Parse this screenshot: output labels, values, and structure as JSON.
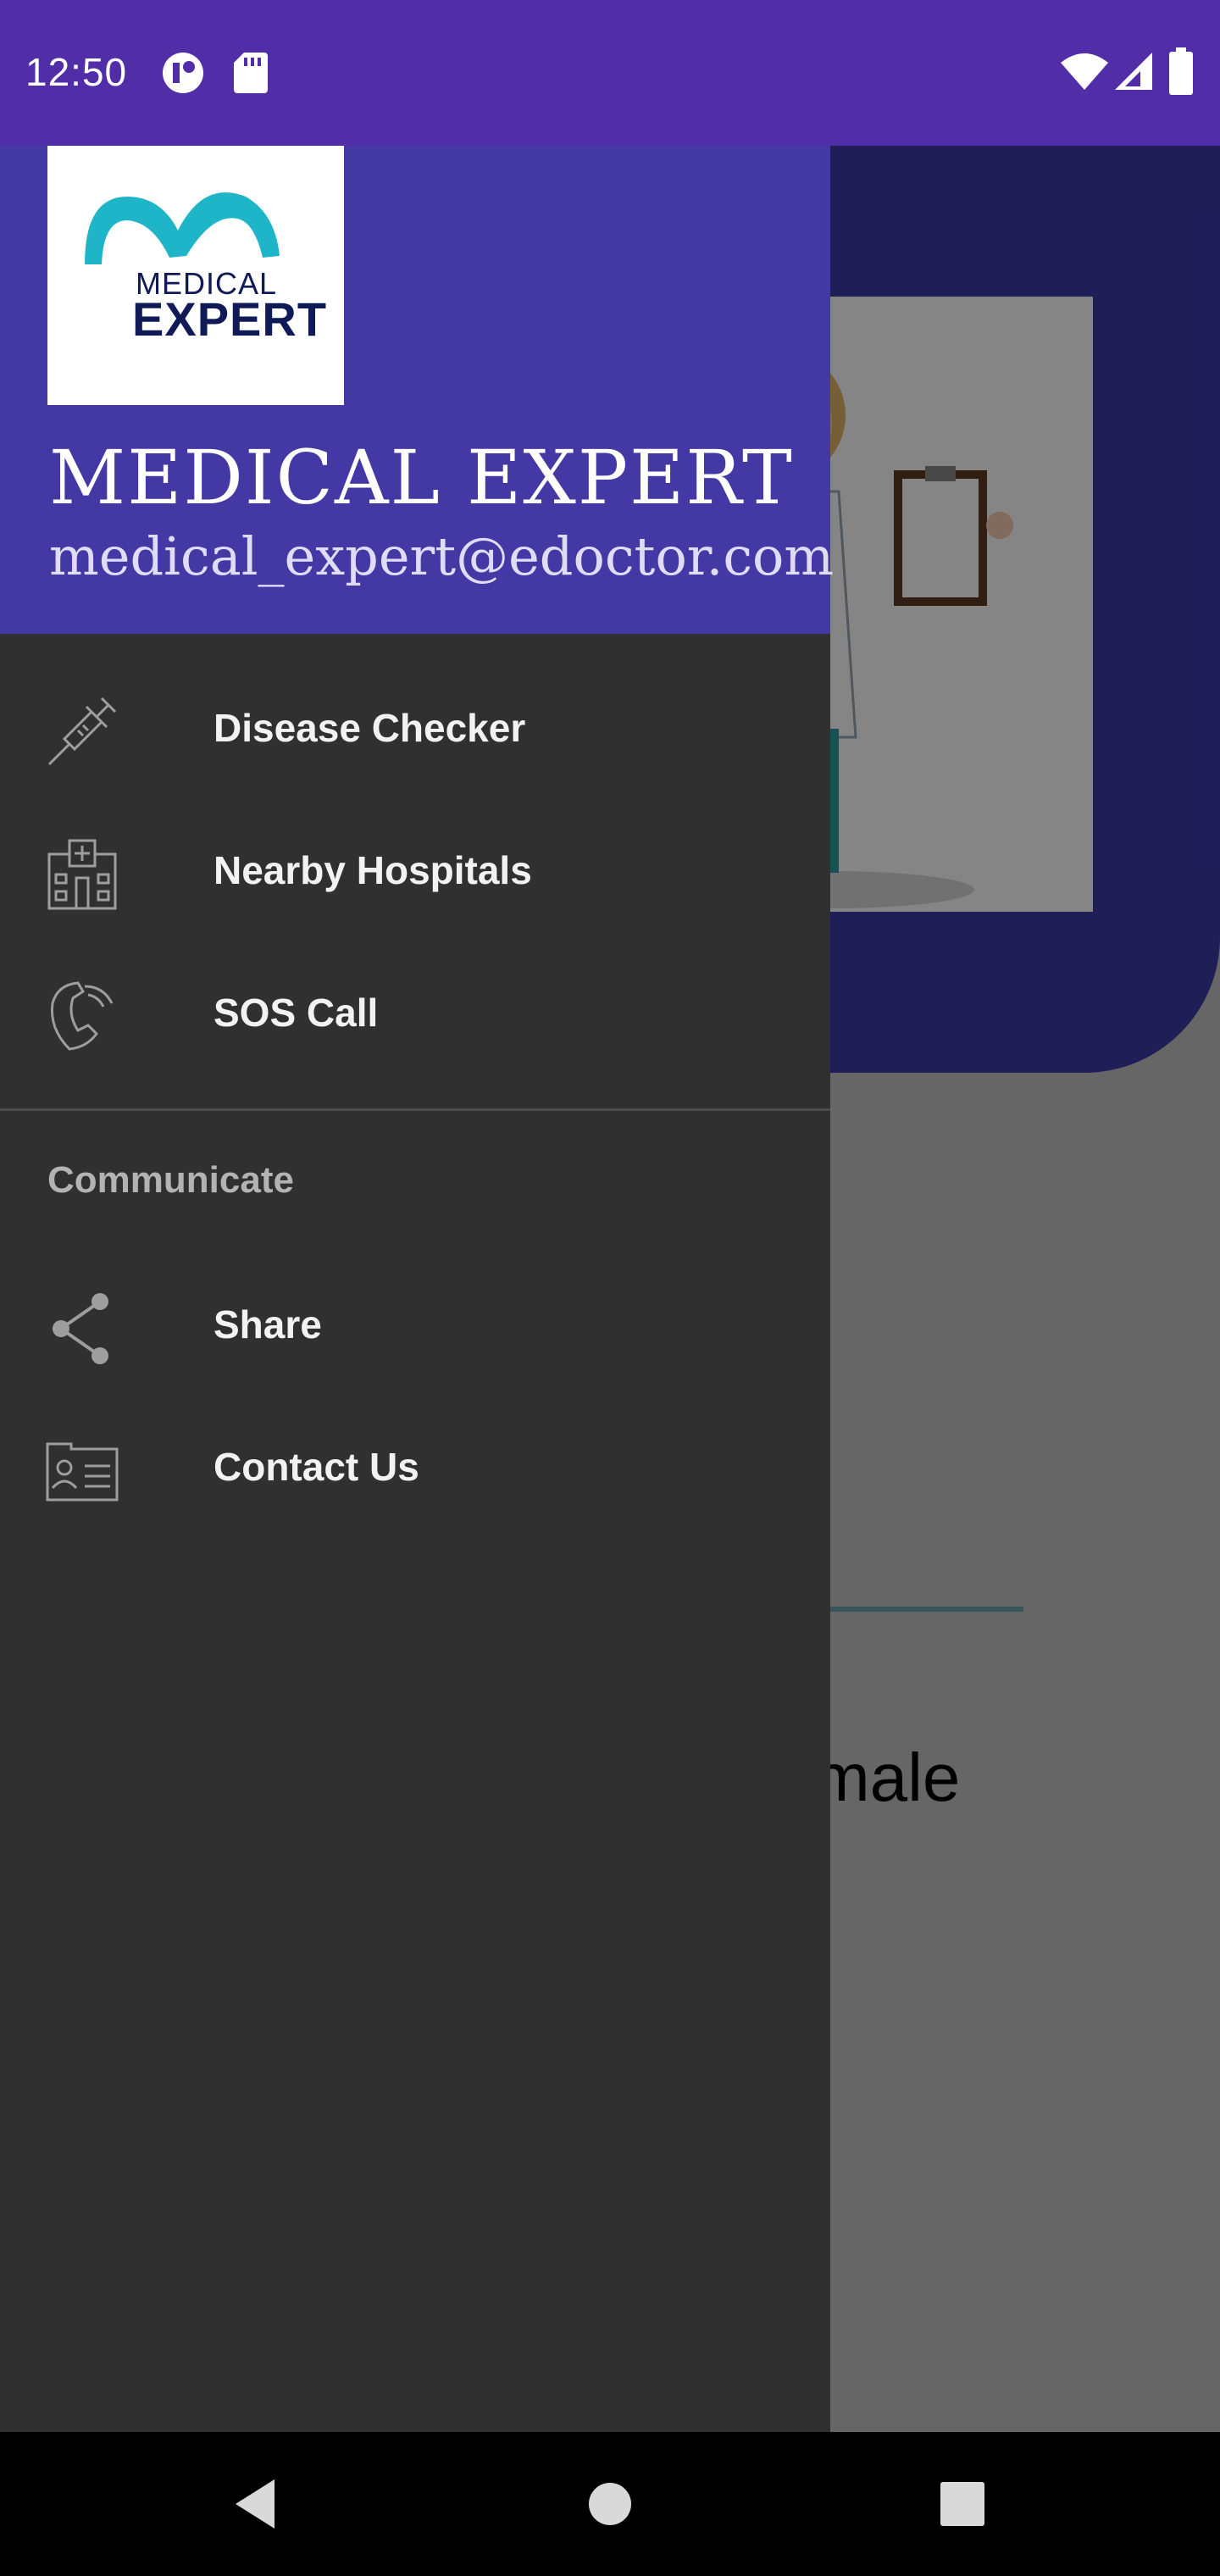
{
  "status_bar": {
    "time": "12:50",
    "icons": [
      "circle-app-icon",
      "sd-card-icon",
      "wifi-icon",
      "signal-icon",
      "battery-icon"
    ]
  },
  "background": {
    "visible_text": "male"
  },
  "drawer": {
    "header": {
      "logo": {
        "line1": "MEDICAL",
        "line2": "EXPERT"
      },
      "title": "MEDICAL EXPERT",
      "email": "medical_expert@edoctor.com"
    },
    "items": [
      {
        "label": "Disease Checker",
        "icon": "syringe-icon"
      },
      {
        "label": "Nearby Hospitals",
        "icon": "hospital-icon"
      },
      {
        "label": "SOS Call",
        "icon": "phone-icon"
      }
    ],
    "section": {
      "title": "Communicate",
      "items": [
        {
          "label": "Share",
          "icon": "share-icon"
        },
        {
          "label": "Contact Us",
          "icon": "contact-card-icon"
        }
      ]
    }
  },
  "nav_bar": {
    "buttons": [
      "back-icon",
      "home-icon",
      "recents-icon"
    ]
  },
  "colors": {
    "status_bar": "#512da8",
    "drawer_header": "#4338a4",
    "drawer_bg": "#303030",
    "logo_teal": "#1fb5c9",
    "logo_navy": "#0f1a57"
  }
}
